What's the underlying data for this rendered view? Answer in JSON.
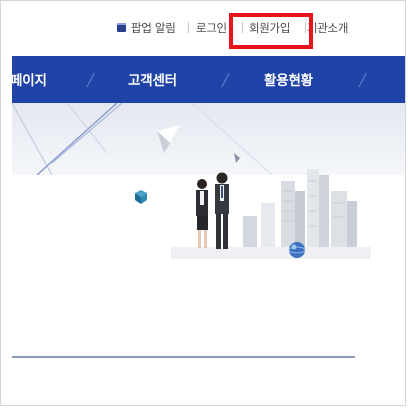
{
  "topbar": {
    "popup_label": "팝업 알림",
    "login_label": "로그인",
    "signup_label": "회원가입",
    "about_label": "기관소개"
  },
  "nav": {
    "items": [
      "페이지",
      "고객센터",
      "활용현황"
    ]
  },
  "colors": {
    "nav_background": "#1f43a6",
    "highlight": "#e8131c"
  }
}
